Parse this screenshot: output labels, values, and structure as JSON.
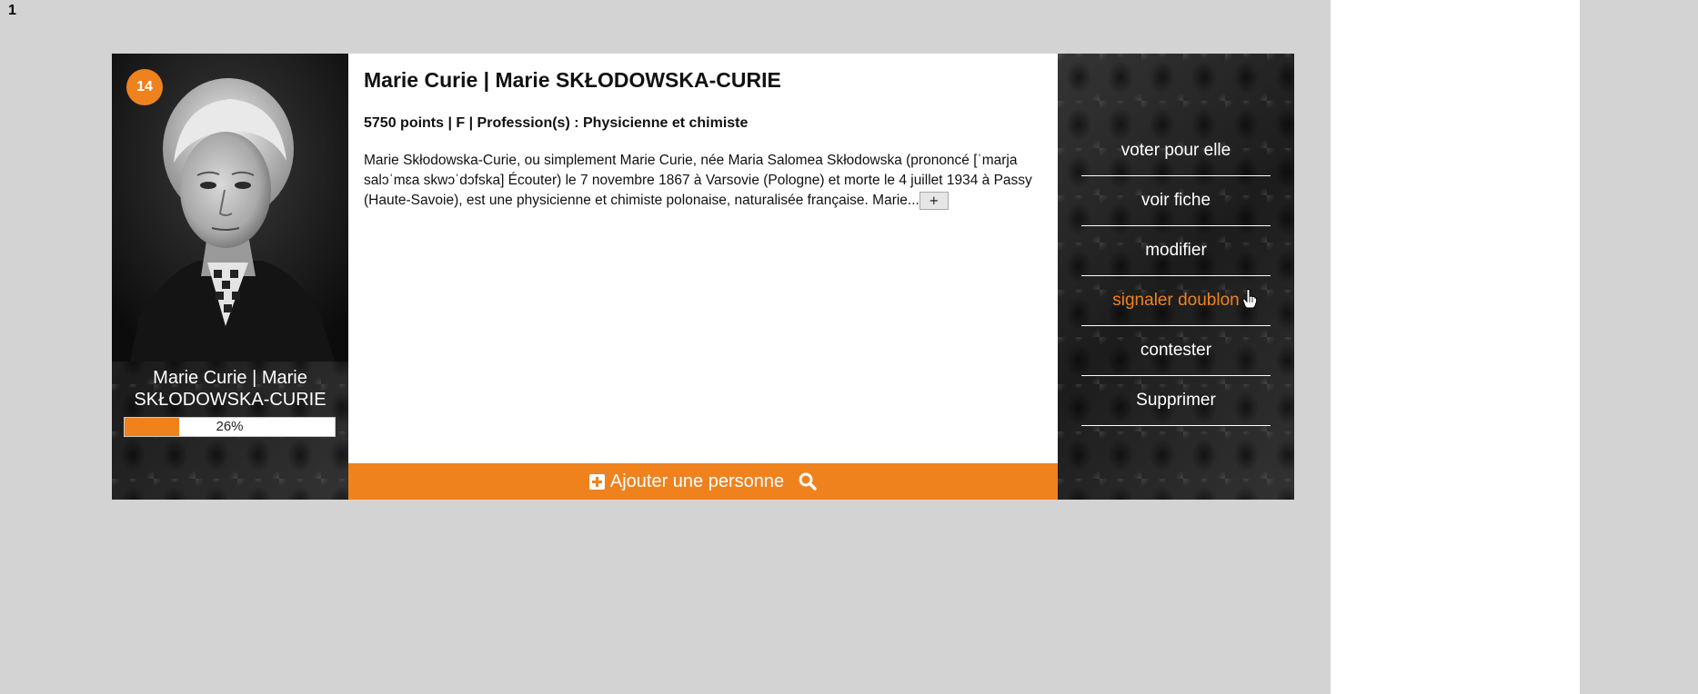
{
  "page_number": "1",
  "card": {
    "rank_badge": "14",
    "person_name": "Marie Curie | Marie SKŁODOWSKA-CURIE",
    "progress": {
      "percent": 26,
      "label": "26%"
    },
    "title": "Marie Curie | Marie SKŁODOWSKA-CURIE",
    "meta": "5750 points | F | Profession(s) : Physicienne et chimiste",
    "description": "Marie Skłodowska-Curie, ou simplement Marie Curie, née Maria Salomea Skłodowska (prononcé [ˈmarja salɔˈmɛa skwɔˈdɔfska] Écouter) le 7 novembre 1867 à Varsovie (Pologne) et morte le 4 juillet 1934 à Passy (Haute-Savoie), est une physicienne et chimiste polonaise, naturalisée française. Marie...",
    "more_button": "+",
    "add_person_label": "Ajouter une personne",
    "accent_color": "#f0821e"
  },
  "menu": {
    "items": [
      {
        "label": "voter pour elle"
      },
      {
        "label": "voir fiche"
      },
      {
        "label": "modifier"
      },
      {
        "label": "signaler doublon",
        "state": "hover"
      },
      {
        "label": "contester"
      },
      {
        "label": "Supprimer"
      }
    ]
  },
  "icons": {
    "add": "plus-square-icon",
    "search": "search-icon",
    "cursor": "hand-pointer-icon"
  }
}
